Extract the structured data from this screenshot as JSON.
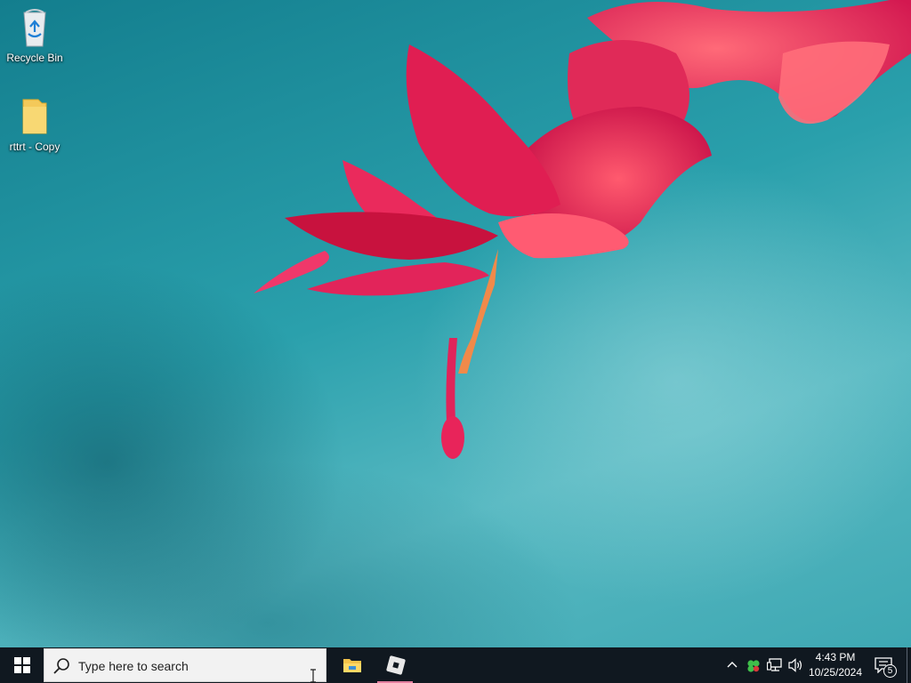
{
  "desktop": {
    "icons": [
      {
        "label": "Recycle Bin",
        "icon": "recycle-bin-icon"
      },
      {
        "label": "rttrt - Copy",
        "icon": "folder-icon"
      }
    ]
  },
  "taskbar": {
    "start_icon": "windows-logo-icon",
    "search": {
      "placeholder": "Type here to search",
      "icon": "search-icon"
    },
    "pinned_apps": [
      {
        "name": "File Explorer",
        "icon": "file-explorer-icon"
      },
      {
        "name": "Roblox",
        "icon": "roblox-icon",
        "active": true
      }
    ],
    "tray": {
      "icons": [
        "chevron-up-icon",
        "clover-app-icon",
        "network-icon",
        "volume-icon"
      ],
      "clock": {
        "time": "4:43 PM",
        "date": "10/25/2024"
      },
      "notifications": {
        "count": "5",
        "icon": "action-center-icon"
      }
    }
  },
  "colors": {
    "taskbar": "#101820",
    "wallpaper_teal": "#2aa0ac",
    "flower_pink": "#e8245a",
    "active_indicator": "#e47fa0"
  }
}
